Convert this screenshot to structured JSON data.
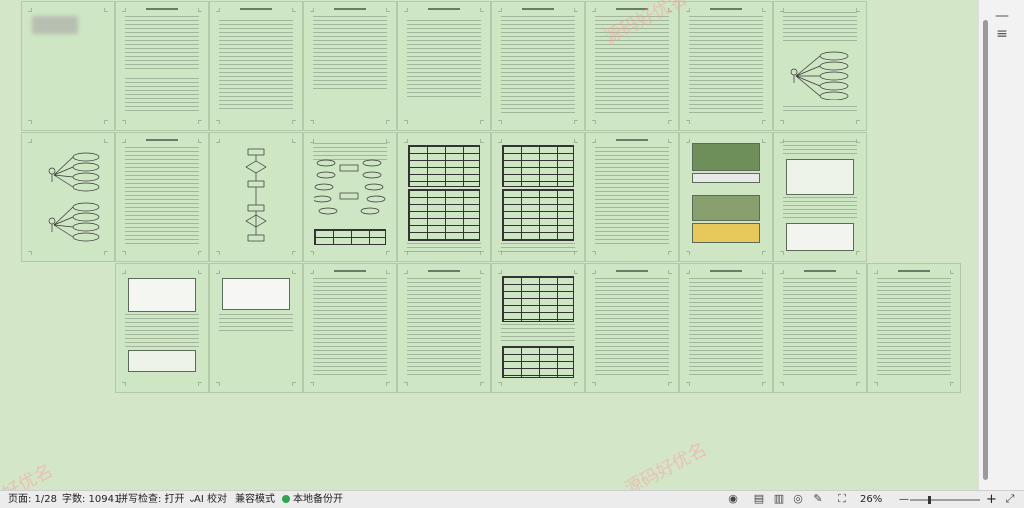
{
  "document": {
    "pages_total": 28,
    "rows": [
      [
        "cover",
        "abstract",
        "toc",
        "toc2",
        "intro",
        "text",
        "text",
        "text",
        "usecase"
      ],
      [
        "usecase2",
        "text",
        "flowchart",
        "er",
        "table",
        "table",
        "text",
        "photos",
        "screens"
      ],
      [
        "screens2",
        "screens3",
        "text",
        "text",
        "table2",
        "text",
        "text",
        "text",
        "text"
      ]
    ]
  },
  "watermark": {
    "texts": [
      "源码好优名",
      "源码好优名",
      "好优名"
    ]
  },
  "scrollbar": {
    "top_icon": "minus-icon",
    "menu_icon": "menu-icon"
  },
  "statusbar": {
    "page": "页面: 1/28",
    "words": "字数: 10941",
    "spell": "拼写检查: 打开",
    "ai": "AI 校对",
    "compat": "兼容模式",
    "backup": "本地备份开",
    "zoom": "26%",
    "zoom_level": 0.26,
    "minus": "—",
    "plus": "+"
  }
}
